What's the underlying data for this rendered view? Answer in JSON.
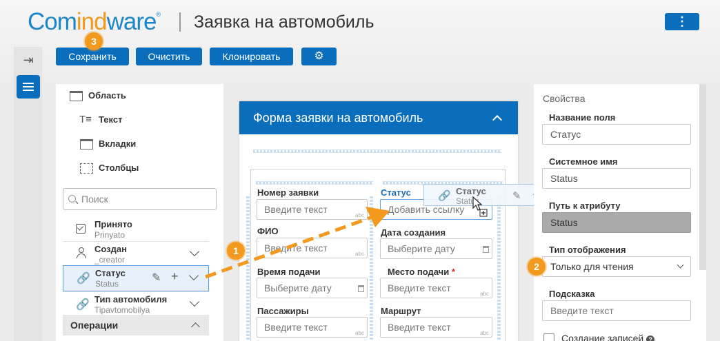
{
  "app": {
    "logo_part1": "Com",
    "logo_part2": "ind",
    "logo_part3": "ware",
    "logo_reg": "®",
    "title": "Заявка на автомобиль",
    "menu_glyph": "⋮"
  },
  "rail": {
    "collapse_glyph": "⇥"
  },
  "toolbar": {
    "save": "Сохранить",
    "clear": "Очистить",
    "clone": "Клонировать",
    "settings_glyph": "⚙"
  },
  "badges": {
    "b1": "1",
    "b2": "2",
    "b3": "3"
  },
  "left_panel": {
    "elements": [
      {
        "label": "Область",
        "icon": "area-icon"
      },
      {
        "label": "Текст",
        "icon": "text-icon"
      },
      {
        "label": "Вкладки",
        "icon": "tabs-icon"
      },
      {
        "label": "Столбцы",
        "icon": "columns-icon"
      }
    ],
    "search_placeholder": "Поиск",
    "attributes": [
      {
        "name": "Принято",
        "system": "Prinyato",
        "icon": "checkbox-icon"
      },
      {
        "name": "Создан",
        "system": "_creator",
        "icon": "user-icon"
      },
      {
        "name": "Статус",
        "system": "Status",
        "icon": "link-icon",
        "selected": true
      },
      {
        "name": "Тип автомобиля",
        "system": "Tipavtomobilya",
        "icon": "link-icon"
      }
    ],
    "operations": "Операции"
  },
  "form": {
    "title": "Форма заявки на автомобиль",
    "fields_left": [
      {
        "label": "Номер заявки",
        "placeholder": "Введите текст",
        "kind": "text"
      },
      {
        "label": "ФИО",
        "placeholder": "Введите текст",
        "kind": "text"
      },
      {
        "label": "Время подачи",
        "placeholder": "Выберите дату",
        "kind": "date"
      },
      {
        "label": "Пассажиры",
        "placeholder": "Введите текст",
        "kind": "text"
      }
    ],
    "fields_right": [
      {
        "label": "Статус",
        "placeholder": "Добавить ссылку",
        "kind": "link"
      },
      {
        "label": "Дата создания",
        "placeholder": "Выберите дату",
        "kind": "date"
      },
      {
        "label": "Место подачи",
        "placeholder": "Введите текст",
        "kind": "text",
        "required": "*"
      },
      {
        "label": "Маршрут",
        "placeholder": "Введите текст",
        "kind": "text"
      }
    ],
    "abc_hint": "abc",
    "drag_ghost": {
      "name": "Статус",
      "system": "Status"
    }
  },
  "properties": {
    "title": "Свойства",
    "field_name_label": "Название поля",
    "field_name_value": "Статус",
    "system_name_label": "Системное имя",
    "system_name_value": "Status",
    "attr_path_label": "Путь к атрибуту",
    "attr_path_value": "Status",
    "display_type_label": "Тип отображения",
    "display_type_value": "Только для чтения",
    "hint_label": "Подсказка",
    "hint_placeholder": "Введите текст",
    "create_records_label": "Создание записей",
    "help_glyph": "?"
  },
  "colors": {
    "brand_blue": "#0a6ebd",
    "logo_orange": "#f39a1e",
    "badge_orange": "#f39a1e"
  }
}
